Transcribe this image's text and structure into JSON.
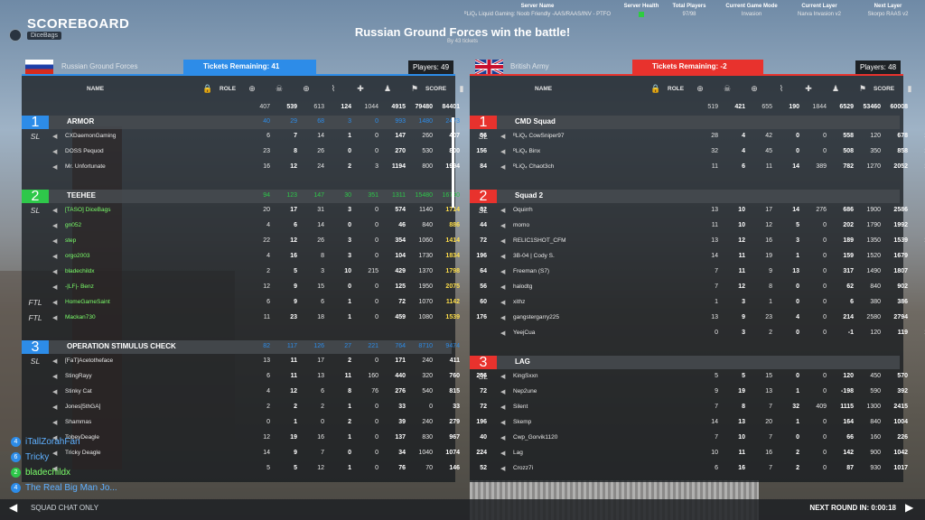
{
  "header": {
    "title": "SCOREBOARD",
    "user": "DiceBags",
    "banner": "Russian Ground Forces win the battle!",
    "banner_sub": "By 43 tickets"
  },
  "server": [
    {
      "h": "Server Name",
      "v": "ᴿLiQ₄ Liquid Gaming: Noob Friendly -AAS/RAAS/INV - PTFO"
    },
    {
      "h": "Server Health",
      "v": ""
    },
    {
      "h": "Total Players",
      "v": "97/98"
    },
    {
      "h": "Current Game Mode",
      "v": "Invasion"
    },
    {
      "h": "Current Layer",
      "v": "Narva Invasion v2"
    },
    {
      "h": "Next Layer",
      "v": "Skorpo RAAS v2"
    }
  ],
  "columns": {
    "name": "NAME",
    "role": "ROLE",
    "score": "SCORE"
  },
  "left": {
    "team": "Russian Ground Forces",
    "tickets": "Tickets Remaining: 41",
    "players": "Players: 49",
    "totals": [
      "407",
      "539",
      "613",
      "124",
      "1044",
      "4915",
      "79480",
      "84401"
    ],
    "squads": [
      {
        "num": "1",
        "name": "ARMOR",
        "stats": [
          "40",
          "29",
          "68",
          "3",
          "0",
          "993",
          "1480",
          "2473"
        ],
        "color": "#2d8ce8",
        "players": [
          {
            "role": "SL",
            "name": "CXDaemonGaming",
            "s": [
              "6",
              "7",
              "14",
              "1",
              "0",
              "147",
              "260",
              "407",
              "56"
            ],
            "green": false
          },
          {
            "role": "",
            "name": "DOSS Pequod",
            "s": [
              "23",
              "8",
              "26",
              "0",
              "0",
              "270",
              "530",
              "800",
              "156"
            ],
            "green": false
          },
          {
            "role": "",
            "name": "Mr. Unfortunate",
            "s": [
              "16",
              "12",
              "24",
              "2",
              "3",
              "1194",
              "800",
              "1994",
              "84"
            ],
            "green": false
          }
        ]
      },
      {
        "num": "2",
        "name": "TEEHEE",
        "stats": [
          "94",
          "123",
          "147",
          "30",
          "351",
          "1311",
          "15480",
          "16790"
        ],
        "color": "#2ec84a",
        "players": [
          {
            "role": "SL",
            "name": "[TASO] DiceBags",
            "s": [
              "20",
              "17",
              "31",
              "3",
              "0",
              "574",
              "1140",
              "1714",
              "32"
            ],
            "green": true
          },
          {
            "role": "",
            "name": "gn052",
            "s": [
              "4",
              "6",
              "14",
              "0",
              "0",
              "46",
              "840",
              "886",
              "44"
            ],
            "green": true
          },
          {
            "role": "",
            "name": "step",
            "s": [
              "22",
              "12",
              "26",
              "3",
              "0",
              "354",
              "1060",
              "1414",
              "72"
            ],
            "green": true
          },
          {
            "role": "",
            "name": "orgo2003",
            "s": [
              "4",
              "16",
              "8",
              "3",
              "0",
              "104",
              "1730",
              "1834",
              "196"
            ],
            "green": true
          },
          {
            "role": "",
            "name": "bladechildx",
            "s": [
              "2",
              "5",
              "3",
              "10",
              "215",
              "429",
              "1370",
              "1798",
              "64"
            ],
            "green": true
          },
          {
            "role": "",
            "name": "-|LF|- Benz",
            "s": [
              "12",
              "9",
              "15",
              "0",
              "0",
              "125",
              "1950",
              "2075",
              "56"
            ],
            "green": true
          },
          {
            "role": "FTL",
            "name": "HomeGameSaint",
            "s": [
              "6",
              "9",
              "6",
              "1",
              "0",
              "72",
              "1070",
              "1142",
              "60"
            ],
            "green": true
          },
          {
            "role": "FTL",
            "name": "Mackan730",
            "s": [
              "11",
              "23",
              "18",
              "1",
              "0",
              "459",
              "1080",
              "1539",
              "176"
            ],
            "green": true
          }
        ]
      },
      {
        "num": "3",
        "name": "OPERATION STIMULUS CHECK",
        "stats": [
          "82",
          "117",
          "126",
          "27",
          "221",
          "764",
          "8710",
          "9474"
        ],
        "color": "#2d8ce8",
        "players": [
          {
            "role": "SL",
            "name": "[FaT]Acetotheface",
            "s": [
              "13",
              "11",
              "17",
              "2",
              "0",
              "171",
              "240",
              "411",
              "68"
            ],
            "green": false
          },
          {
            "role": "",
            "name": "StingRayy",
            "s": [
              "6",
              "11",
              "13",
              "11",
              "160",
              "440",
              "320",
              "760",
              "256"
            ],
            "green": false
          },
          {
            "role": "",
            "name": "Stinky Cat",
            "s": [
              "4",
              "12",
              "6",
              "8",
              "76",
              "276",
              "540",
              "815",
              "72"
            ],
            "green": false
          },
          {
            "role": "",
            "name": "Jones[5thGA]",
            "s": [
              "2",
              "2",
              "2",
              "1",
              "0",
              "33",
              "0",
              "33",
              "72"
            ],
            "green": false
          },
          {
            "role": "",
            "name": "Shammas",
            "s": [
              "0",
              "1",
              "0",
              "2",
              "0",
              "39",
              "240",
              "279",
              "196"
            ],
            "green": false
          },
          {
            "role": "",
            "name": "TobeyDeagle",
            "s": [
              "12",
              "19",
              "16",
              "1",
              "0",
              "137",
              "830",
              "967",
              "40"
            ],
            "green": false
          },
          {
            "role": "",
            "name": "Tricky Deagle",
            "s": [
              "14",
              "9",
              "7",
              "0",
              "0",
              "34",
              "1040",
              "1074",
              "224"
            ],
            "green": false
          },
          {
            "role": "",
            "name": "",
            "s": [
              "5",
              "5",
              "12",
              "1",
              "0",
              "76",
              "70",
              "146",
              "52"
            ],
            "green": false
          }
        ]
      }
    ]
  },
  "right": {
    "team": "British Army",
    "tickets": "Tickets Remaining: -2",
    "players": "Players: 48",
    "totals": [
      "519",
      "421",
      "655",
      "190",
      "1844",
      "6529",
      "53460",
      "60008"
    ],
    "squads": [
      {
        "num": "1",
        "name": "CMD Squad",
        "stats": [
          "",
          "",
          "",
          "",
          "",
          "",
          "",
          ""
        ],
        "color": "#e8322d",
        "players": [
          {
            "role": "SL",
            "name": "ᴿLiQ₄ CowSniper97",
            "s": [
              "28",
              "4",
              "42",
              "0",
              "0",
              "558",
              "120",
              "678",
              "176"
            ]
          },
          {
            "role": "",
            "name": "ᴿLiQ₄ Binx",
            "s": [
              "32",
              "4",
              "45",
              "0",
              "0",
              "508",
              "350",
              "858",
              "108"
            ]
          },
          {
            "role": "",
            "name": "ᴿLiQ₄ Chaot3ch",
            "s": [
              "11",
              "6",
              "11",
              "14",
              "389",
              "782",
              "1270",
              "2052",
              "164"
            ]
          }
        ]
      },
      {
        "num": "2",
        "name": "Squad 2",
        "stats": [
          "",
          "",
          "",
          "",
          "",
          "",
          "",
          ""
        ],
        "color": "#e8322d",
        "players": [
          {
            "role": "SL",
            "name": "Oquirrh",
            "s": [
              "13",
              "10",
              "17",
              "14",
              "276",
              "686",
              "1900",
              "2586",
              "68"
            ]
          },
          {
            "role": "",
            "name": "momo",
            "s": [
              "11",
              "10",
              "12",
              "5",
              "0",
              "202",
              "1790",
              "1992",
              "36"
            ]
          },
          {
            "role": "",
            "name": "RELIC1SHOT_CFM",
            "s": [
              "13",
              "12",
              "16",
              "3",
              "0",
              "189",
              "1350",
              "1539",
              "108"
            ]
          },
          {
            "role": "",
            "name": "3B-04 | Cody S.",
            "s": [
              "14",
              "11",
              "19",
              "1",
              "0",
              "159",
              "1520",
              "1679",
              "32"
            ]
          },
          {
            "role": "",
            "name": "Freeman (S7)",
            "s": [
              "7",
              "11",
              "9",
              "13",
              "0",
              "317",
              "1490",
              "1807",
              "48"
            ]
          },
          {
            "role": "",
            "name": "halodtg",
            "s": [
              "7",
              "12",
              "8",
              "0",
              "0",
              "62",
              "840",
              "902",
              "64"
            ]
          },
          {
            "role": "",
            "name": "xithz",
            "s": [
              "1",
              "3",
              "1",
              "0",
              "0",
              "6",
              "380",
              "386",
              "72"
            ]
          },
          {
            "role": "",
            "name": "gangstergarry225",
            "s": [
              "13",
              "9",
              "23",
              "4",
              "0",
              "214",
              "2580",
              "2794",
              "28"
            ]
          },
          {
            "role": "",
            "name": "YeejCua",
            "s": [
              "0",
              "3",
              "2",
              "0",
              "0",
              "-1",
              "120",
              "119",
              "168"
            ]
          }
        ]
      },
      {
        "num": "3",
        "name": "LAG",
        "stats": [
          "",
          "",
          "",
          "",
          "",
          "",
          "",
          ""
        ],
        "color": "#e8322d",
        "players": [
          {
            "role": "SL",
            "name": "KingSxxn",
            "s": [
              "5",
              "5",
              "15",
              "0",
              "0",
              "120",
              "450",
              "570",
              "56"
            ]
          },
          {
            "role": "",
            "name": "Nep2une",
            "s": [
              "9",
              "19",
              "13",
              "1",
              "0",
              "-198",
              "590",
              "392",
              "44"
            ]
          },
          {
            "role": "",
            "name": "Silent",
            "s": [
              "7",
              "8",
              "7",
              "32",
              "409",
              "1115",
              "1300",
              "2415",
              "52"
            ]
          },
          {
            "role": "",
            "name": "Skemp",
            "s": [
              "14",
              "13",
              "20",
              "1",
              "0",
              "164",
              "840",
              "1004",
              "68"
            ]
          },
          {
            "role": "",
            "name": "Cwp_Gorvik1120",
            "s": [
              "7",
              "10",
              "7",
              "0",
              "0",
              "66",
              "160",
              "226",
              "40"
            ]
          },
          {
            "role": "",
            "name": "Lag",
            "s": [
              "10",
              "11",
              "16",
              "2",
              "0",
              "142",
              "900",
              "1042",
              "60"
            ]
          },
          {
            "role": "",
            "name": "Crozz7i",
            "s": [
              "6",
              "16",
              "7",
              "2",
              "0",
              "87",
              "930",
              "1017",
              "72"
            ]
          }
        ]
      }
    ]
  },
  "chat": [
    {
      "badge": "4",
      "color": "#2d8ce8",
      "name": "iTallZorahFan",
      "tcolor": "#5fb0ff"
    },
    {
      "badge": "6",
      "color": "#2d8ce8",
      "name": "Tricky",
      "tcolor": "#5fb0ff"
    },
    {
      "badge": "2",
      "color": "#2ec84a",
      "name": "bladechildx",
      "tcolor": "#7bff6a"
    },
    {
      "badge": "4",
      "color": "#2d8ce8",
      "name": "The Real Big Man Jo...",
      "tcolor": "#5fb0ff"
    }
  ],
  "footer": {
    "squad_chat": "SQUAD CHAT ONLY",
    "next_round": "NEXT ROUND IN: 0:00:18"
  }
}
